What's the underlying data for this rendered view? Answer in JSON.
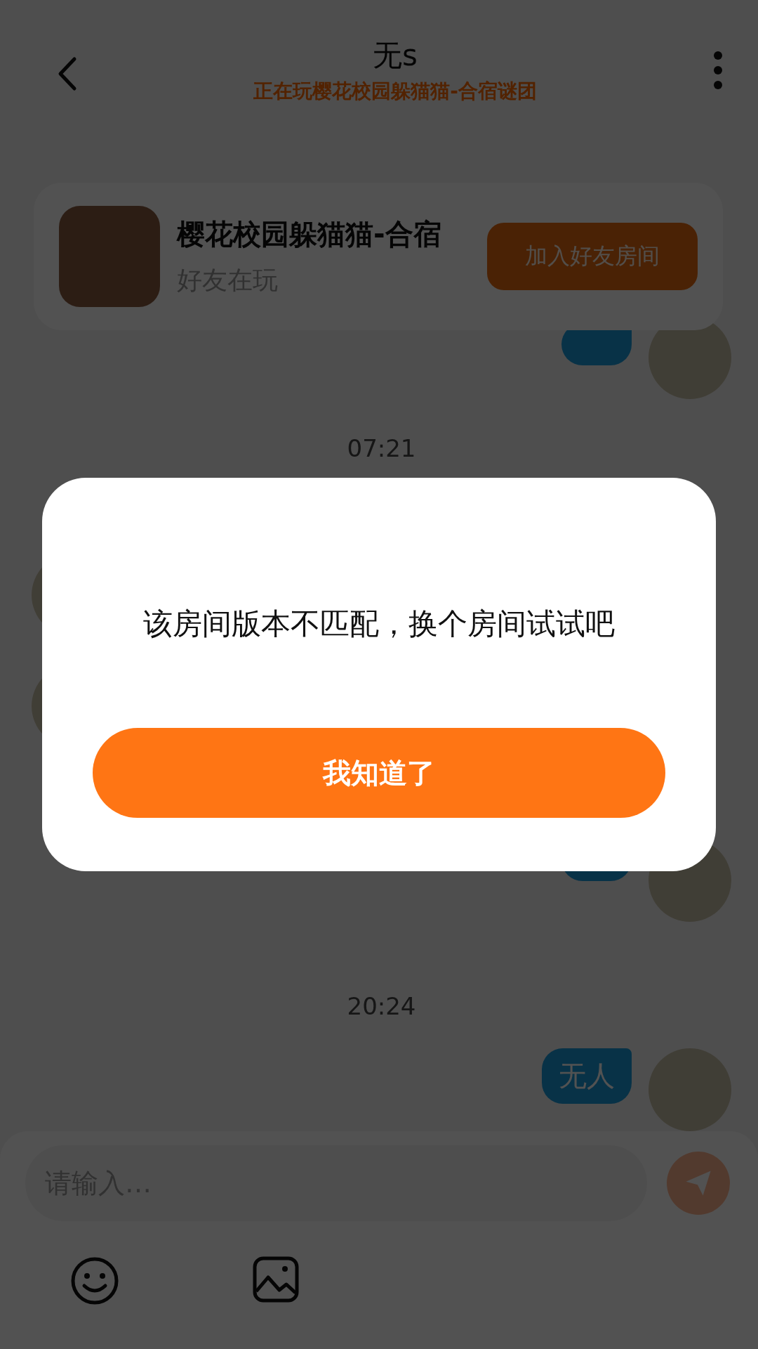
{
  "header": {
    "title": "无s",
    "subtitle": "正在玩樱花校园躲猫猫-合宿谜团"
  },
  "game_card": {
    "title": "樱花校园躲猫猫-合宿",
    "status": "好友在玩",
    "join_button": "加入好友房间"
  },
  "messages": [
    {
      "kind": "sent"
    },
    {
      "kind": "time",
      "text": "07:21"
    },
    {
      "kind": "received"
    },
    {
      "kind": "received"
    },
    {
      "kind": "sent"
    },
    {
      "kind": "time",
      "text": "20:24"
    },
    {
      "kind": "sent",
      "text": "无人"
    }
  ],
  "input": {
    "placeholder": "请输入…"
  },
  "dialog": {
    "message": "该房间版本不匹配，换个房间试试吧",
    "confirm_button": "我知道了"
  }
}
